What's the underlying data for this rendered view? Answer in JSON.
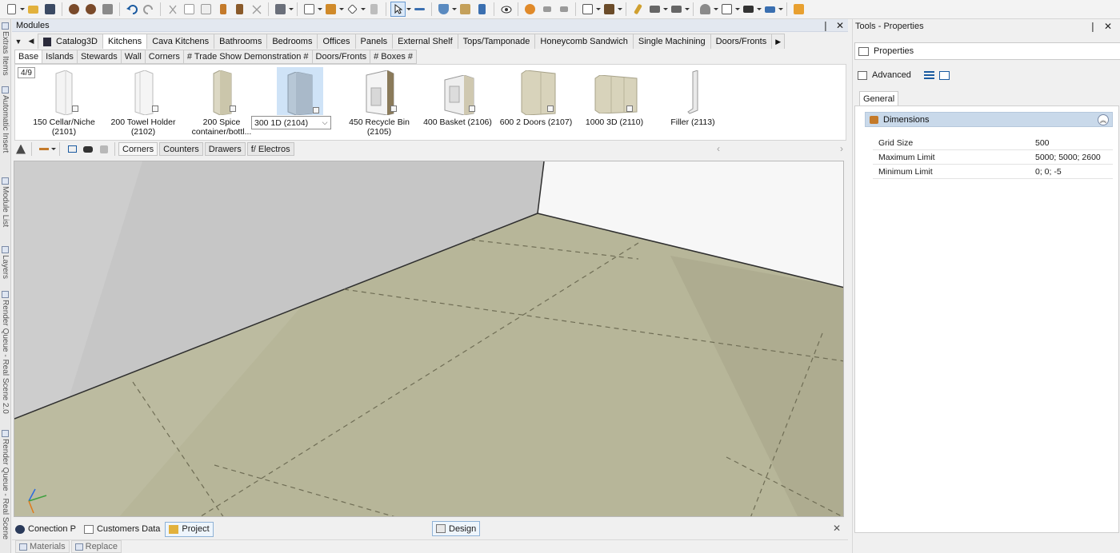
{
  "modules_panel": {
    "title": "Modules",
    "pin_glyph": "❘",
    "close_glyph": "✕",
    "catalog_tabs": [
      "Catalog3D",
      "Kitchens",
      "Cava Kitchens",
      "Bathrooms",
      "Bedrooms",
      "Offices",
      "Panels",
      "External Shelf",
      "Tops/Tamponade",
      "Honeycomb Sandwich",
      "Single Machining",
      "Doors/Fronts"
    ],
    "active_catalog_tab": "Kitchens",
    "sub_tabs": [
      "Base",
      "Islands",
      "Stewards",
      "Wall",
      "Corners",
      "# Trade Show Demonstration #",
      "Doors/Fronts",
      "# Boxes #"
    ],
    "page_indicator": "4/9",
    "items": [
      {
        "label": "150 Cellar/Niche (2101)"
      },
      {
        "label": "200 Towel Holder (2102)"
      },
      {
        "label": "200 Spice container/bottl... (2103)"
      },
      {
        "label": "300 1D (2104)"
      },
      {
        "label": "450 Recycle Bin (2105)"
      },
      {
        "label": "400 Basket (2106)"
      },
      {
        "label": "600 2 Doors (2107)"
      },
      {
        "label": "1000 3D (2110)"
      },
      {
        "label": "Filler (2113)"
      }
    ],
    "item_label_lines": {
      "i0": [
        "150 Cellar/Niche",
        "(2101)"
      ],
      "i1": [
        "200 Towel Holder",
        "(2102)"
      ],
      "i2": [
        "200 Spice",
        "container/bottl..."
      ],
      "i4": [
        "450 Recycle Bin",
        "(2105)"
      ],
      "i5": [
        "400 Basket (2106)"
      ],
      "i6": [
        "600 2 Doors (2107)"
      ],
      "i7": [
        "1000 3D (2110)"
      ],
      "i8": [
        "Filler (2113)"
      ]
    },
    "selected_item": "300 1D (2104)"
  },
  "filter_tabs": [
    "Corners",
    "Counters",
    "Drawers",
    "f/ Electros"
  ],
  "bottom_tabs": {
    "connection": "Conection P",
    "customers": "Customers Data",
    "project": "Project",
    "design": "Design",
    "close_glyph": "✕"
  },
  "bottom_strip": [
    "Materials",
    "Replace"
  ],
  "left_strip_labels": [
    "Extras Items",
    "Automatic Insert",
    "Module List",
    "Layers",
    "Render Queue - Real Scene 2.0",
    "Render Queue - Real Scene"
  ],
  "tools_panel": {
    "title": "Tools - Properties",
    "pin_glyph": "❘",
    "close_glyph": "✕",
    "properties_label": "Properties",
    "advanced_label": "Advanced",
    "general_tab": "General",
    "section": "Dimensions",
    "rows": [
      {
        "key": "Grid Size",
        "value": "500"
      },
      {
        "key": "Maximum Limit",
        "value": "5000; 5000; 2600"
      },
      {
        "key": "Minimum Limit",
        "value": "0; 0; -5"
      }
    ]
  },
  "colors": {
    "floor": "#b7b699",
    "wall_left": "#c7c7c7",
    "wall_right": "#f7f7f7",
    "selected_item": "#cfe3f7",
    "section_header": "#c9d9ea"
  }
}
